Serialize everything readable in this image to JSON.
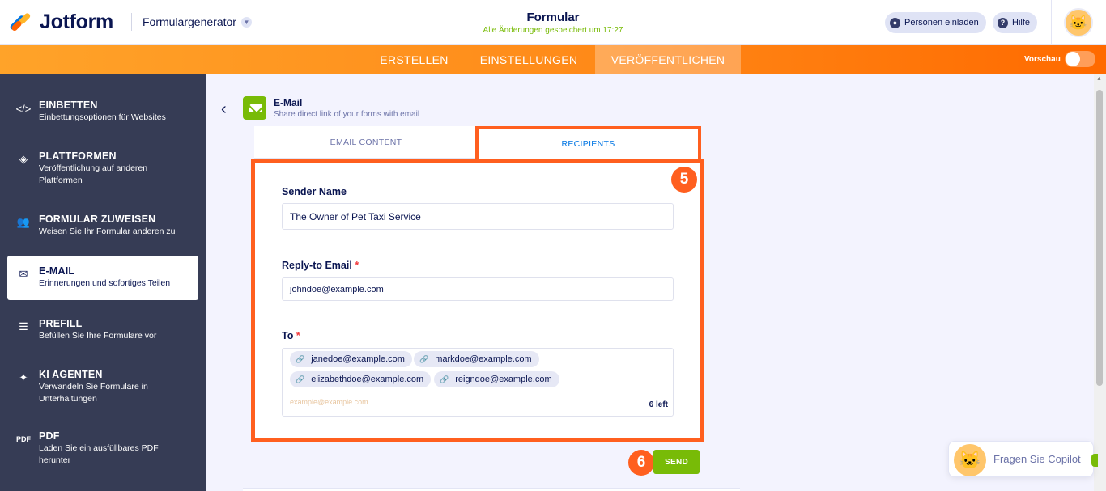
{
  "header": {
    "brand": "Jotform",
    "builder_label": "Formulargenerator",
    "form_title": "Formular",
    "save_status": "Alle Änderungen gespeichert um 17:27",
    "invite_label": "Personen einladen",
    "help_label": "Hilfe"
  },
  "nav": {
    "tabs": [
      {
        "label": "ERSTELLEN"
      },
      {
        "label": "EINSTELLUNGEN"
      },
      {
        "label": "VERÖFFENTLICHEN"
      }
    ],
    "preview_label": "Vorschau",
    "preview_on": false
  },
  "sidebar": {
    "items": [
      {
        "title": "EINBETTEN",
        "desc": "Einbettungsoptionen für Websites",
        "icon": "code-icon"
      },
      {
        "title": "PLATTFORMEN",
        "desc": "Veröffentlichung auf anderen Plattformen",
        "icon": "layers-icon"
      },
      {
        "title": "FORMULAR ZUWEISEN",
        "desc": "Weisen Sie Ihr Formular anderen zu",
        "icon": "users-icon"
      },
      {
        "title": "E-MAIL",
        "desc": "Erinnerungen und sofortiges Teilen",
        "icon": "mail-icon",
        "active": true
      },
      {
        "title": "PREFILL",
        "desc": "Befüllen Sie Ihre Formulare vor",
        "icon": "prefill-icon"
      },
      {
        "title": "KI AGENTEN",
        "desc": "Verwandeln Sie Formulare in Unterhaltungen",
        "icon": "sparkle-icon"
      },
      {
        "title": "PDF",
        "desc": "Laden Sie ein ausfüllbares PDF herunter",
        "icon": "pdf-icon"
      }
    ]
  },
  "email_panel": {
    "title": "E-Mail",
    "subtitle": "Share direct link of your forms with email",
    "tabs": [
      "EMAIL CONTENT",
      "RECIPIENTS"
    ],
    "active_tab": "RECIPIENTS",
    "step_badge_1": "5",
    "step_badge_2": "6",
    "sender_name_label": "Sender Name",
    "sender_name_value": "The Owner of Pet Taxi Service",
    "reply_to_label": "Reply-to Email",
    "reply_to_value": "johndoe@example.com",
    "to_label": "To",
    "required_mark": "*",
    "recipients": [
      "janedoe@example.com",
      "markdoe@example.com",
      "elizabethdoe@example.com",
      "reigndoe@example.com"
    ],
    "to_placeholder": "example@example.com",
    "remaining": "6 left",
    "send_label": "SEND"
  },
  "copilot": {
    "label": "Fragen Sie Copilot"
  },
  "colors": {
    "accent_orange": "#ff5f1f",
    "send_green": "#78bb07",
    "link_blue": "#0075e3",
    "sidebar_bg": "#363c55"
  }
}
